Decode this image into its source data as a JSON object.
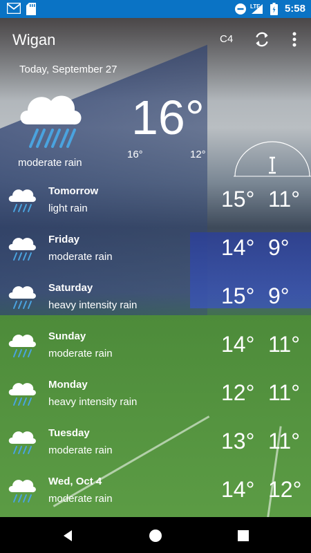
{
  "status_bar": {
    "time": "5:58",
    "icons": [
      "gmail-icon",
      "sd-card-icon",
      "dnd-icon",
      "lte-icon",
      "battery-icon"
    ],
    "network": "LTE"
  },
  "app": {
    "city": "Wigan",
    "code": "C4"
  },
  "current": {
    "date": "Today, September 27",
    "temp": "16°",
    "condition": "moderate rain",
    "high": "16°",
    "low": "12°"
  },
  "forecast": [
    {
      "day": "Tomorrow",
      "desc": "light rain",
      "hi": "15°",
      "lo": "11°"
    },
    {
      "day": "Friday",
      "desc": "moderate rain",
      "hi": "14°",
      "lo": "9°"
    },
    {
      "day": "Saturday",
      "desc": "heavy intensity rain",
      "hi": "15°",
      "lo": "9°"
    },
    {
      "day": "Sunday",
      "desc": "moderate rain",
      "hi": "14°",
      "lo": "11°"
    },
    {
      "day": "Monday",
      "desc": "heavy intensity rain",
      "hi": "12°",
      "lo": "11°"
    },
    {
      "day": "Tuesday",
      "desc": "moderate rain",
      "hi": "13°",
      "lo": "11°"
    },
    {
      "day": "Wed, Oct 4",
      "desc": "moderate rain",
      "hi": "14°",
      "lo": "12°"
    }
  ],
  "colors": {
    "status_bar": "#0a73c5",
    "rain": "#4aa3df"
  }
}
